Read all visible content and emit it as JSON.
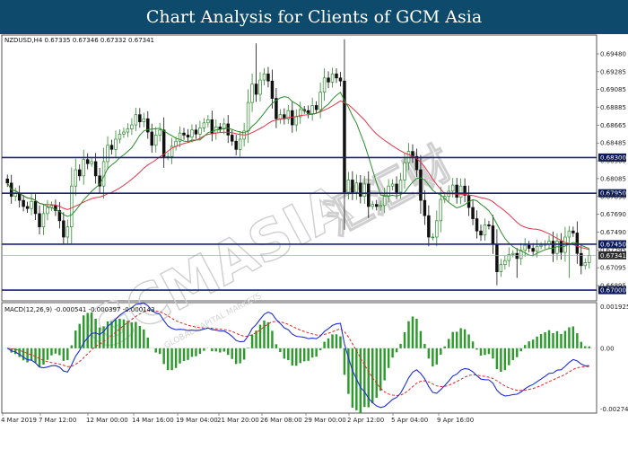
{
  "banner": {
    "title": "Chart Analysis for Clients of GCM Asia"
  },
  "watermark": {
    "brand": "GCMASIA",
    "suffix": "汇汇财",
    "tagline": "GLOBAL CAPITAL MARKETS"
  },
  "chart_data": {
    "type": "candlestick",
    "symbol_header": "NZDUSD,H4  0.67335 0.67346 0.67332 0.67341",
    "ylim": [
      0.66895,
      0.69501
    ],
    "y_ticks": [
      "0.69480",
      "0.69285",
      "0.69085",
      "0.68885",
      "0.68665",
      "0.68485",
      "0.68300",
      "0.68085",
      "0.67890",
      "0.67690",
      "0.67490",
      "0.67295",
      "0.67095",
      "0.66895"
    ],
    "x_ticks": [
      "4 Mar 2019",
      "7 Mar 12:00",
      "12 Mar 00:00",
      "14 Mar 16:00",
      "19 Mar 04:00",
      "21 Mar 20:00",
      "26 Mar 08:00",
      "29 Mar 00:00",
      "2 Apr 12:00",
      "5 Apr 04:00",
      "9 Apr 16:00"
    ],
    "levels": [
      {
        "value": 0.683,
        "label": "0.68300"
      },
      {
        "value": 0.6795,
        "label": "0.67950"
      },
      {
        "value": 0.6745,
        "label": "0.67450"
      },
      {
        "value": 0.67,
        "label": "0.67000"
      }
    ],
    "current": {
      "value": 0.67341,
      "label": "0.67341"
    },
    "close": [
      0.6805,
      0.6792,
      0.6795,
      0.6788,
      0.6782,
      0.678,
      0.6787,
      0.6775,
      0.6762,
      0.6775,
      0.6781,
      0.6783,
      0.6778,
      0.6768,
      0.6752,
      0.6762,
      0.6802,
      0.6818,
      0.6812,
      0.6828,
      0.6824,
      0.6826,
      0.6812,
      0.6802,
      0.6826,
      0.6842,
      0.6838,
      0.6848,
      0.6853,
      0.6855,
      0.6858,
      0.6862,
      0.6872,
      0.6865,
      0.6868,
      0.6855,
      0.6842,
      0.6852,
      0.6857,
      0.6831,
      0.6831,
      0.6841,
      0.6846,
      0.6854,
      0.6852,
      0.685,
      0.6857,
      0.6853,
      0.6859,
      0.6864,
      0.6867,
      0.6854,
      0.686,
      0.6858,
      0.6863,
      0.6852,
      0.6846,
      0.6838,
      0.6848,
      0.6856,
      0.6884,
      0.6902,
      0.6892,
      0.6906,
      0.6912,
      0.6905,
      0.6888,
      0.6868,
      0.6872,
      0.6868,
      0.6876,
      0.6862,
      0.687,
      0.6877,
      0.6876,
      0.6873,
      0.6881,
      0.6877,
      0.6894,
      0.6908,
      0.6904,
      0.6912,
      0.6908,
      0.6905,
      0.6796,
      0.6808,
      0.6796,
      0.6805,
      0.6792,
      0.6804,
      0.6782,
      0.6784,
      0.6782,
      0.6783,
      0.6792,
      0.6802,
      0.6804,
      0.6796,
      0.6808,
      0.6825,
      0.6836,
      0.6831,
      0.6818,
      0.6788,
      0.6773,
      0.6752,
      0.6752,
      0.6768,
      0.6789,
      0.6792,
      0.6797,
      0.6803,
      0.6791,
      0.6802,
      0.6793,
      0.6781,
      0.677,
      0.6758,
      0.6754,
      0.6764,
      0.6763,
      0.6745,
      0.6718,
      0.6725,
      0.6729,
      0.6735,
      0.6736,
      0.6731,
      0.6739,
      0.6744,
      0.6741,
      0.6738,
      0.6743,
      0.6744,
      0.6745,
      0.6748,
      0.6736,
      0.6748,
      0.6737,
      0.6752,
      0.6758,
      0.6756,
      0.6736,
      0.6724,
      0.6727,
      0.6734
    ],
    "indicator": {
      "label": "MACD(12,26,9) -0.000541 -0.000397 -0.000143",
      "ylim": [
        -0.00274,
        0.00193
      ],
      "y_ticks": [
        "0.001925",
        "0.00",
        "-0.002747"
      ],
      "macd_color": "#1f2fd8",
      "signal_color": "#e0252b",
      "hist_color": "#2e9a2e"
    },
    "colors": {
      "up": "#2c8a2c",
      "down": "#111111",
      "ma_fast": "#2a8f2a",
      "ma_slow": "#e23448",
      "level_line": "#1a237e",
      "badge": "#0b1a5c"
    },
    "grid": false
  }
}
